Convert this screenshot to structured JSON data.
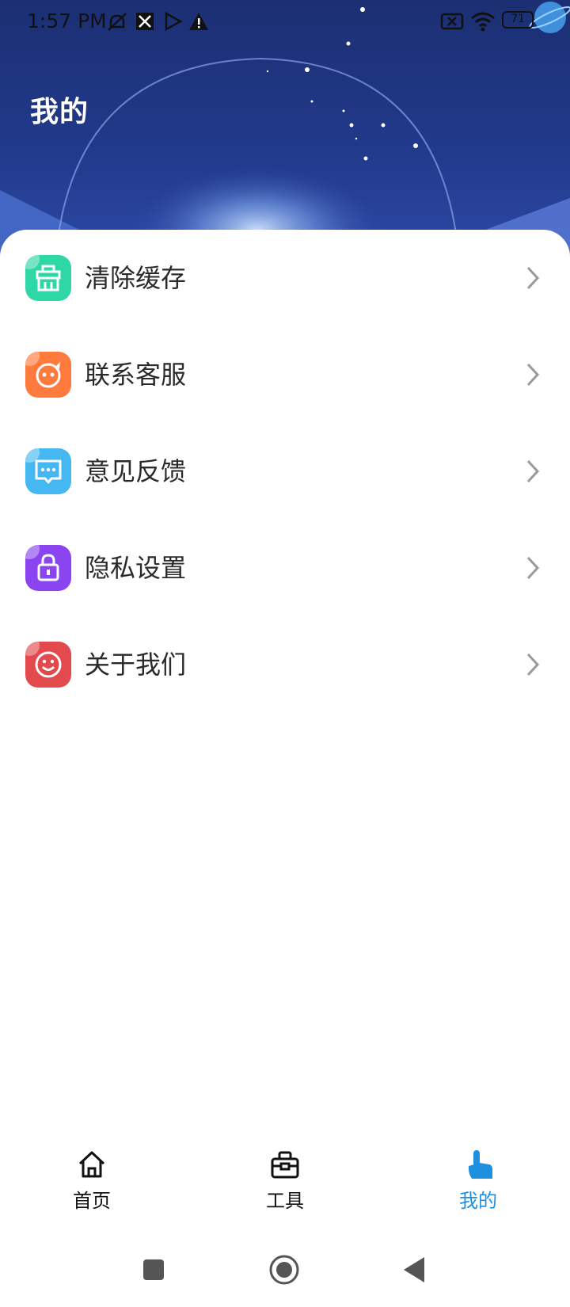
{
  "status_bar": {
    "time": "1:57 PM",
    "battery_level": "71",
    "icons": [
      "mute-icon",
      "app-notification-icon",
      "play-icon",
      "warning-icon",
      "sim-off-icon",
      "wifi-icon",
      "battery-icon"
    ]
  },
  "header": {
    "title": "我的",
    "background_color": "#21398a"
  },
  "menu": {
    "items": [
      {
        "label": "清除缓存",
        "icon": "broom-icon",
        "color": "#2fd6a6"
      },
      {
        "label": "联系客服",
        "icon": "service-icon",
        "color": "#ff7a3d"
      },
      {
        "label": "意见反馈",
        "icon": "chat-icon",
        "color": "#45b8f2"
      },
      {
        "label": "隐私设置",
        "icon": "lock-icon",
        "color": "#8b45f0"
      },
      {
        "label": "关于我们",
        "icon": "smile-icon",
        "color": "#e24a4e"
      }
    ]
  },
  "bottom_nav": {
    "items": [
      {
        "label": "首页",
        "icon": "home-icon"
      },
      {
        "label": "工具",
        "icon": "toolbox-icon"
      },
      {
        "label": "我的",
        "icon": "tap-hand-icon",
        "active": true
      }
    ],
    "active_color": "#1f8fe0"
  },
  "system_nav": {
    "buttons": [
      "recent-apps-button",
      "home-button",
      "back-button"
    ]
  }
}
